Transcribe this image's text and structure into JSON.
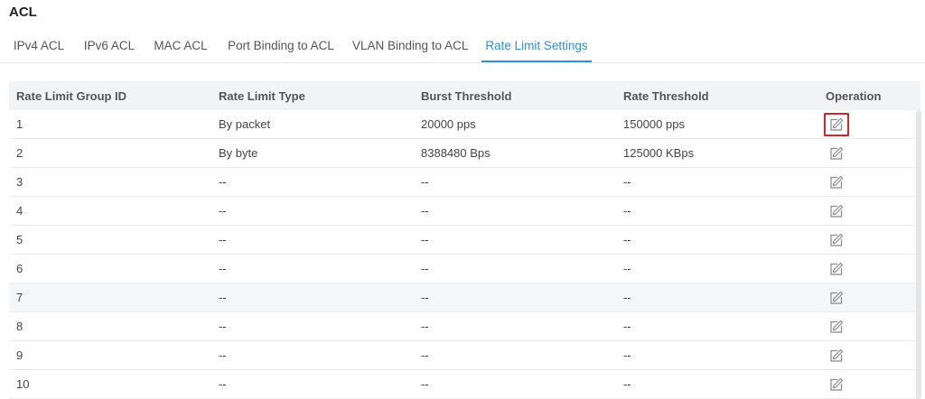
{
  "page": {
    "title": "ACL"
  },
  "tabs": [
    {
      "label": "IPv4 ACL",
      "active": false
    },
    {
      "label": "IPv6 ACL",
      "active": false
    },
    {
      "label": "MAC ACL",
      "active": false
    },
    {
      "label": "Port Binding to ACL",
      "active": false
    },
    {
      "label": "VLAN Binding to ACL",
      "active": false
    },
    {
      "label": "Rate Limit Settings",
      "active": true
    }
  ],
  "table": {
    "columns": [
      "Rate Limit Group ID",
      "Rate Limit Type",
      "Burst Threshold",
      "Rate Threshold",
      "Operation"
    ],
    "rows": [
      {
        "id": "1",
        "type": "By packet",
        "burst": "20000 pps",
        "rate": "150000 pps",
        "highlighted": false,
        "selected": true
      },
      {
        "id": "2",
        "type": "By byte",
        "burst": "8388480 Bps",
        "rate": "125000 KBps",
        "highlighted": false,
        "selected": false
      },
      {
        "id": "3",
        "type": "--",
        "burst": "--",
        "rate": "--",
        "highlighted": false,
        "selected": false
      },
      {
        "id": "4",
        "type": "--",
        "burst": "--",
        "rate": "--",
        "highlighted": false,
        "selected": false
      },
      {
        "id": "5",
        "type": "--",
        "burst": "--",
        "rate": "--",
        "highlighted": false,
        "selected": false
      },
      {
        "id": "6",
        "type": "--",
        "burst": "--",
        "rate": "--",
        "highlighted": false,
        "selected": false
      },
      {
        "id": "7",
        "type": "--",
        "burst": "--",
        "rate": "--",
        "highlighted": true,
        "selected": false
      },
      {
        "id": "8",
        "type": "--",
        "burst": "--",
        "rate": "--",
        "highlighted": false,
        "selected": false
      },
      {
        "id": "9",
        "type": "--",
        "burst": "--",
        "rate": "--",
        "highlighted": false,
        "selected": false
      },
      {
        "id": "10",
        "type": "--",
        "burst": "--",
        "rate": "--",
        "highlighted": false,
        "selected": false
      }
    ],
    "operation_icon": "edit-icon"
  },
  "colors": {
    "accent": "#2f8fd8",
    "highlight_border": "#d7262b",
    "header_bg": "#f2f3f5"
  }
}
